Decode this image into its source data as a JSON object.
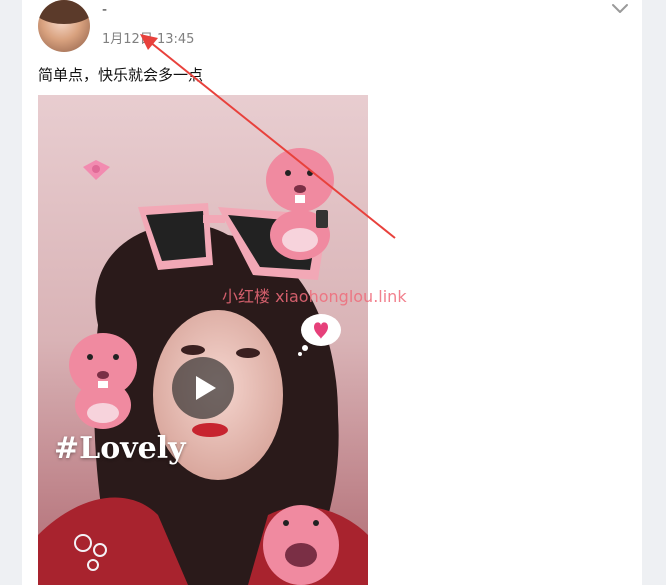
{
  "post": {
    "author_name": "-",
    "timestamp": "1月12日 13:45",
    "caption": "简单点，快乐就会多一点",
    "overlay_text": "#Lovely"
  },
  "watermark": {
    "text": "小红楼  xiaohonglou.link"
  },
  "icons": {
    "menu": "chevron-down-icon",
    "play": "play-icon"
  },
  "colors": {
    "annotation_arrow": "#e8413c",
    "watermark": "#ef6b7a",
    "sticker_pink": "#f08aa0"
  }
}
